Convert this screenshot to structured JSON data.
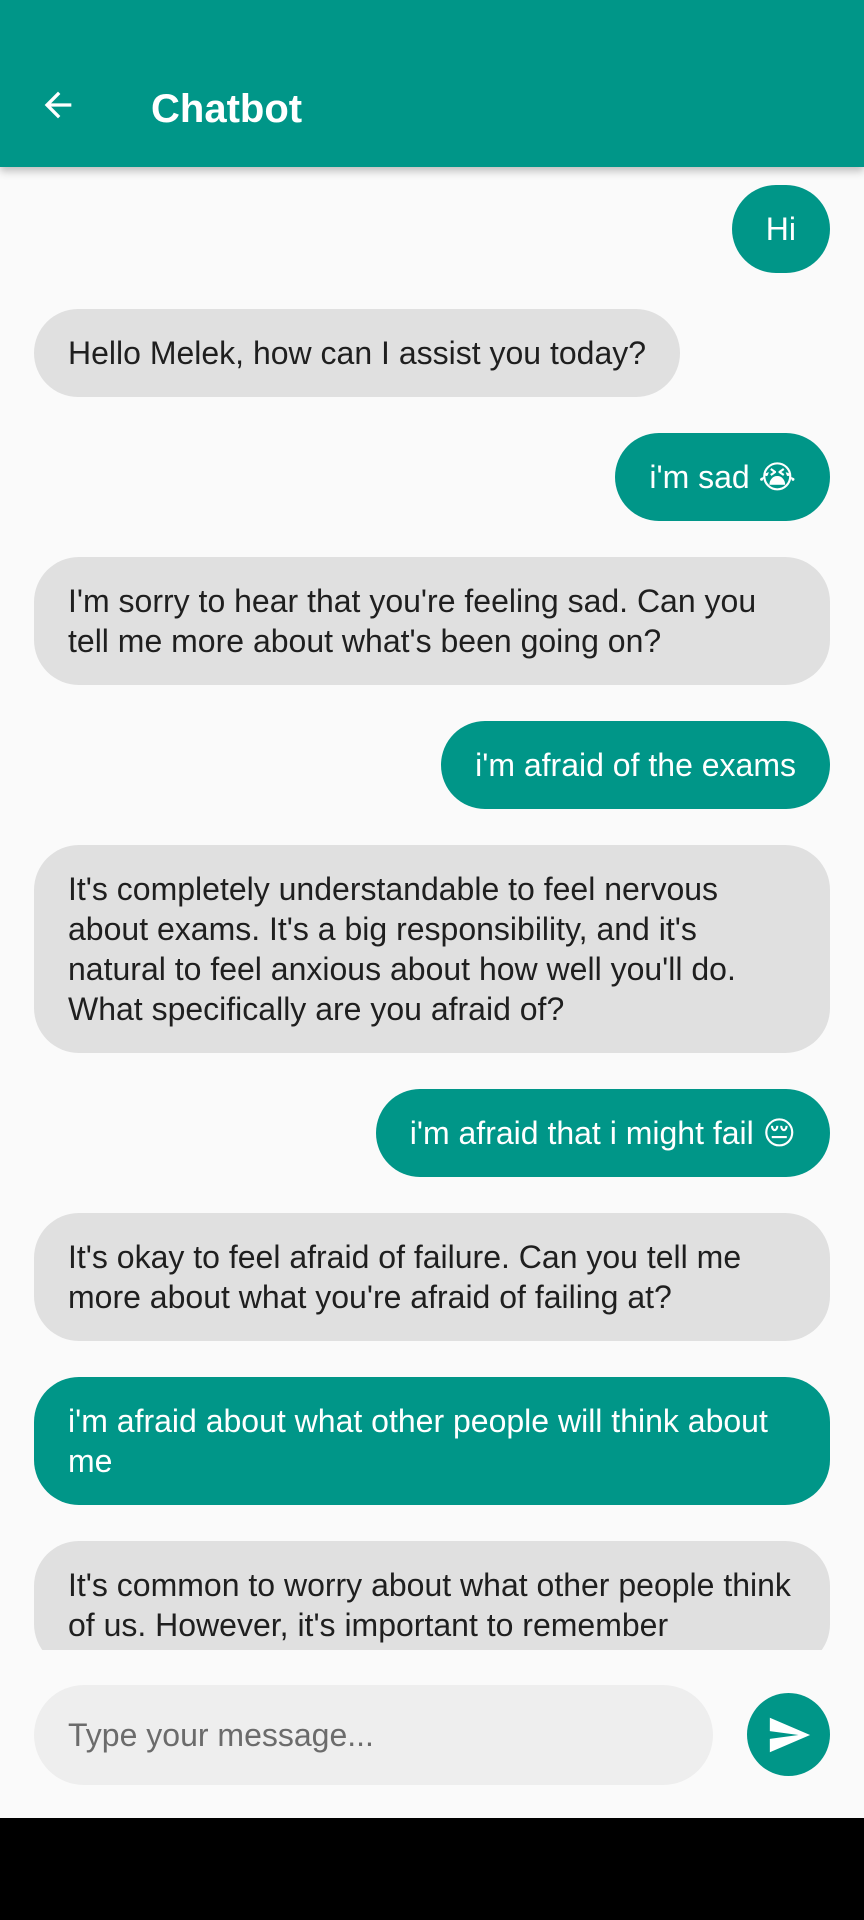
{
  "colors": {
    "primary": "#009688",
    "bot_bubble": "#e0e0e0",
    "background": "#fafafa"
  },
  "appbar": {
    "title": "Chatbot",
    "back_icon": "arrow-back-icon"
  },
  "messages": [
    {
      "sender": "user",
      "text": "Hi"
    },
    {
      "sender": "bot",
      "text": "Hello Melek, how can I assist you today?"
    },
    {
      "sender": "user",
      "text": "i'm sad 😭"
    },
    {
      "sender": "bot",
      "text": "I'm sorry to hear that you're feeling sad. Can you tell me more about what's been going on?"
    },
    {
      "sender": "user",
      "text": "i'm afraid of the exams"
    },
    {
      "sender": "bot",
      "text": "It's completely understandable to feel nervous about exams. It's a big responsibility, and it's natural to feel anxious about how well you'll do. What specifically are you afraid of?"
    },
    {
      "sender": "user",
      "text": "i'm afraid that i might fail 😔"
    },
    {
      "sender": "bot",
      "text": "It's okay to feel afraid of failure. Can you tell me more about what you're afraid of failing at?"
    },
    {
      "sender": "user",
      "text": "i'm afraid about what other people will think about me"
    },
    {
      "sender": "bot",
      "text": "It's common to worry about what other people think of us. However, it's important to remember"
    }
  ],
  "composer": {
    "placeholder": "Type your message...",
    "send_icon": "send-icon"
  }
}
